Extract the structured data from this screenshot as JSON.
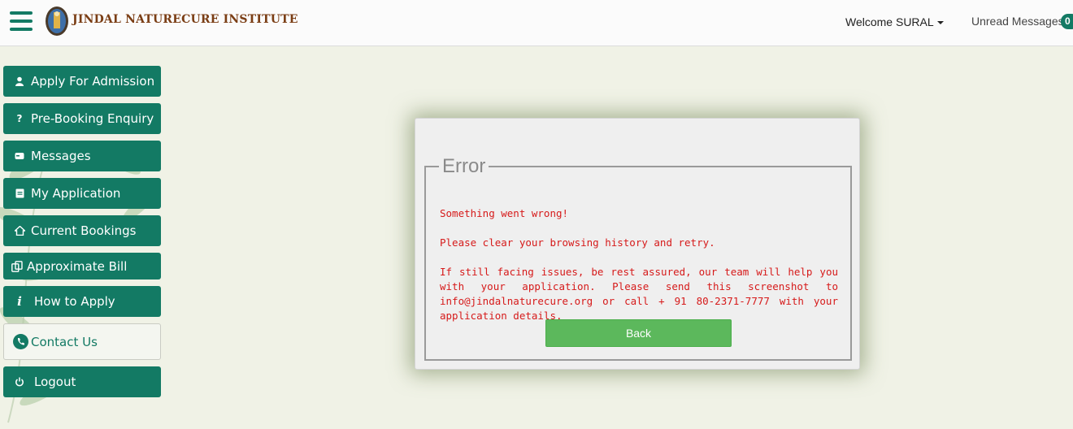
{
  "header": {
    "brand": "JINDAL NATURECURE INSTITUTE",
    "welcome": "Welcome SURAL",
    "unread_label": "Unread Messages",
    "unread_count": "0"
  },
  "sidebar": {
    "items": [
      {
        "label": "Apply For Admission",
        "icon": "user-icon"
      },
      {
        "label": "Pre-Booking Enquiry",
        "icon": "question-icon"
      },
      {
        "label": "Messages",
        "icon": "message-icon"
      },
      {
        "label": "My Application",
        "icon": "document-icon"
      },
      {
        "label": "Current Bookings",
        "icon": "home-icon"
      },
      {
        "label": "Approximate Bill",
        "icon": "copy-icon"
      },
      {
        "label": "How to Apply",
        "icon": "info-icon"
      },
      {
        "label": "Contact Us",
        "icon": "phone-icon"
      },
      {
        "label": "Logout",
        "icon": "power-icon"
      }
    ]
  },
  "dialog": {
    "title": "Error",
    "line1": "Something went wrong!",
    "line2": "Please clear your browsing history and retry.",
    "line3": "If still facing issues, be rest assured, our team will help you with your application. Please send this screenshot to info@jindalnaturecure.org or call + 91 80-2371-7777 with your application details.",
    "back_label": "Back"
  },
  "colors": {
    "brand_green": "#137a64",
    "error_red": "#d61a1a",
    "button_green": "#5cb85c"
  }
}
